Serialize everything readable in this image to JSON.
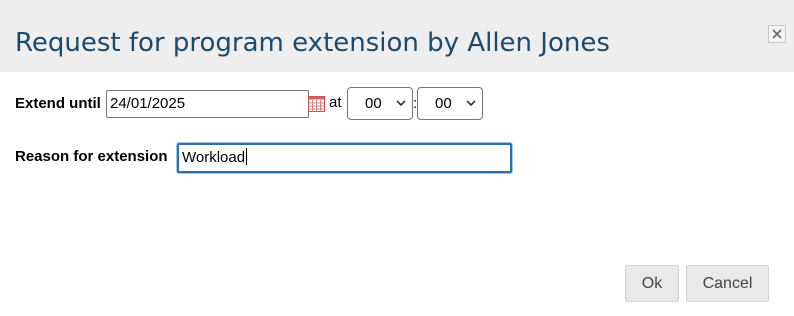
{
  "dialog": {
    "title": "Request for program extension by Allen Jones",
    "close_icon": "close-icon"
  },
  "form": {
    "extend_until_label": "Extend until",
    "date_value": "24/01/2025",
    "calendar_icon": "calendar-icon",
    "at_label": "at",
    "hour_value": "00",
    "time_separator": ":",
    "minute_value": "00",
    "reason_label": "Reason for extension",
    "reason_value": "Workload"
  },
  "buttons": {
    "ok_label": "Ok",
    "cancel_label": "Cancel"
  },
  "colors": {
    "title": "#1d4a6c",
    "titlebar_bg": "#eeeeee",
    "focus_border": "#2b6fae",
    "button_bg": "#e9e9e9"
  }
}
